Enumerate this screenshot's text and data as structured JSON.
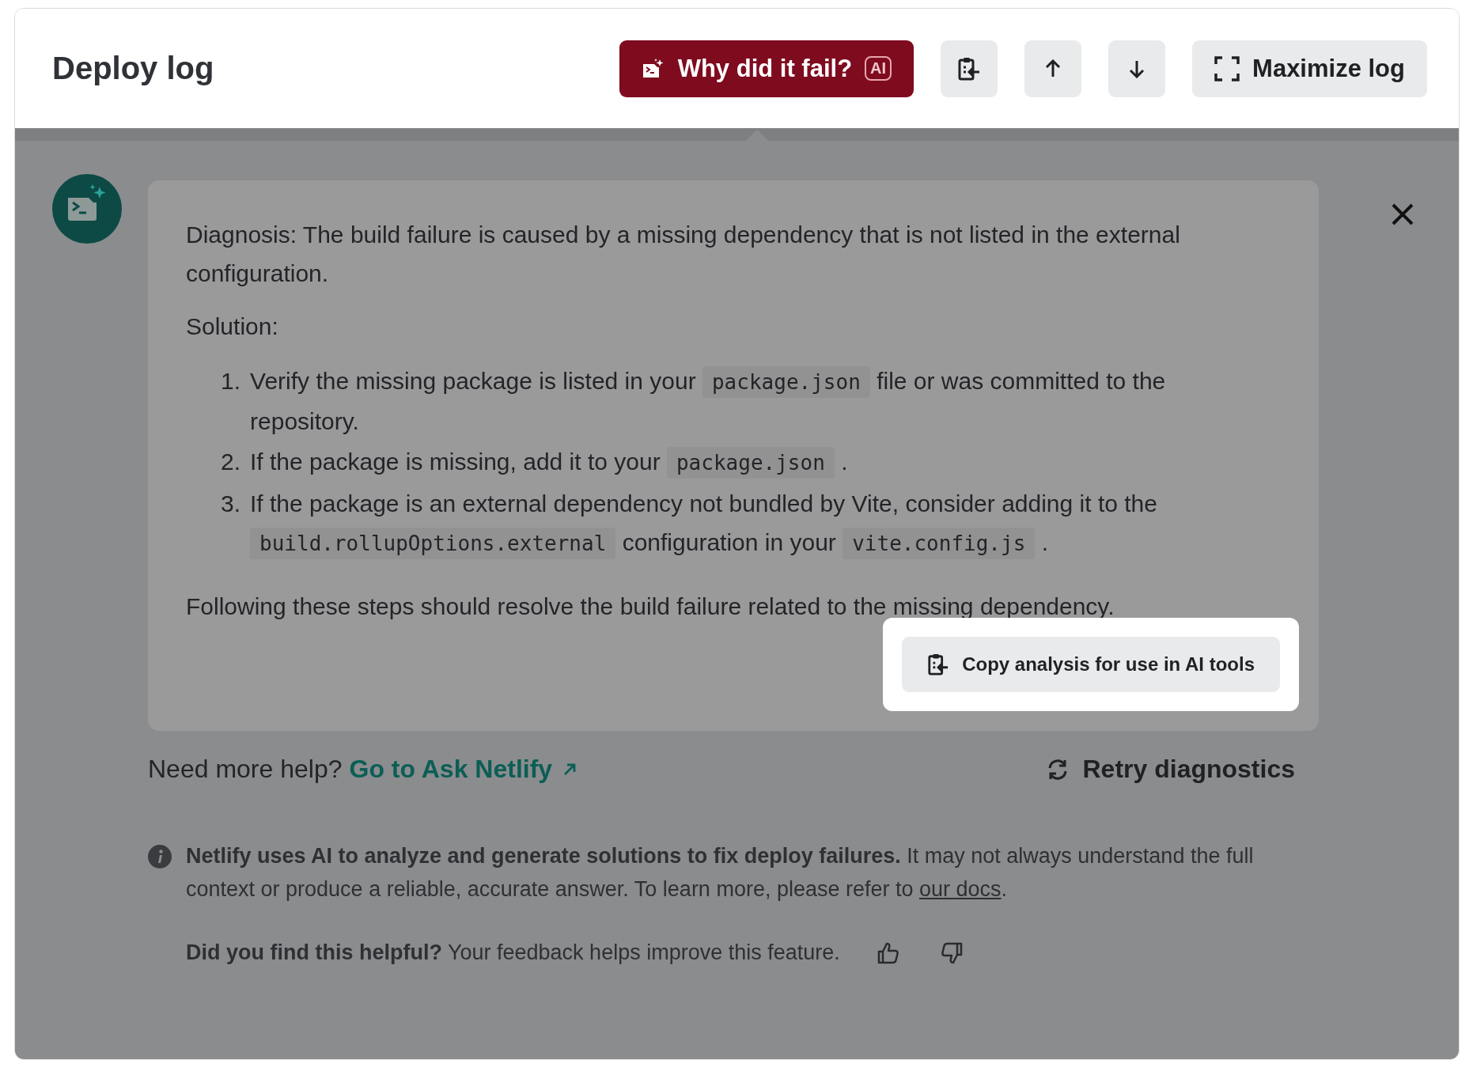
{
  "header": {
    "title": "Deploy log",
    "buttons": [
      {
        "kind": "ai",
        "label": "Why did it fail?",
        "badge": "AI"
      },
      {
        "kind": "copy"
      },
      {
        "kind": "up"
      },
      {
        "kind": "down"
      },
      {
        "kind": "maximize",
        "label": "Maximize log"
      }
    ]
  },
  "analysis": {
    "diagnosis": "Diagnosis: The build failure is caused by a missing dependency that is not listed in the external configuration.",
    "solution_heading": "Solution:",
    "steps": [
      {
        "number": "1.",
        "parts": [
          {
            "kind": "text",
            "text": "Verify the missing package is listed in your "
          },
          {
            "kind": "code",
            "text": "package.json"
          },
          {
            "kind": "text",
            "text": " file or was committed to the repository."
          }
        ]
      },
      {
        "number": "2.",
        "parts": [
          {
            "kind": "text",
            "text": "If the package is missing, add it to your "
          },
          {
            "kind": "code",
            "text": "package.json"
          },
          {
            "kind": "text",
            "text": " ."
          }
        ]
      },
      {
        "number": "3.",
        "parts": [
          {
            "kind": "text",
            "text": "If the package is an external dependency not bundled by Vite, consider adding it to the "
          },
          {
            "kind": "code",
            "text": "build.rollupOptions.external"
          },
          {
            "kind": "text",
            "text": " configuration in your "
          },
          {
            "kind": "code",
            "text": "vite.config.js"
          },
          {
            "kind": "text",
            "text": " ."
          }
        ]
      }
    ],
    "conclusion": "Following these steps should resolve the build failure related to the missing dependency.",
    "copy_button": "Copy analysis for use in AI tools"
  },
  "help": {
    "prompt": "Need more help?",
    "link": "Go to Ask Netlify",
    "retry": "Retry diagnostics"
  },
  "disclaimer": {
    "text": "**Netlify uses AI to analyze and generate solutions to fix deploy failures.** It may not always understand the full context or produce a reliable, accurate answer. To learn more, please refer to ",
    "link": "our docs",
    "after": "."
  },
  "feedback": {
    "question": "**Did you find this helpful?** Your feedback helps improve this feature."
  }
}
